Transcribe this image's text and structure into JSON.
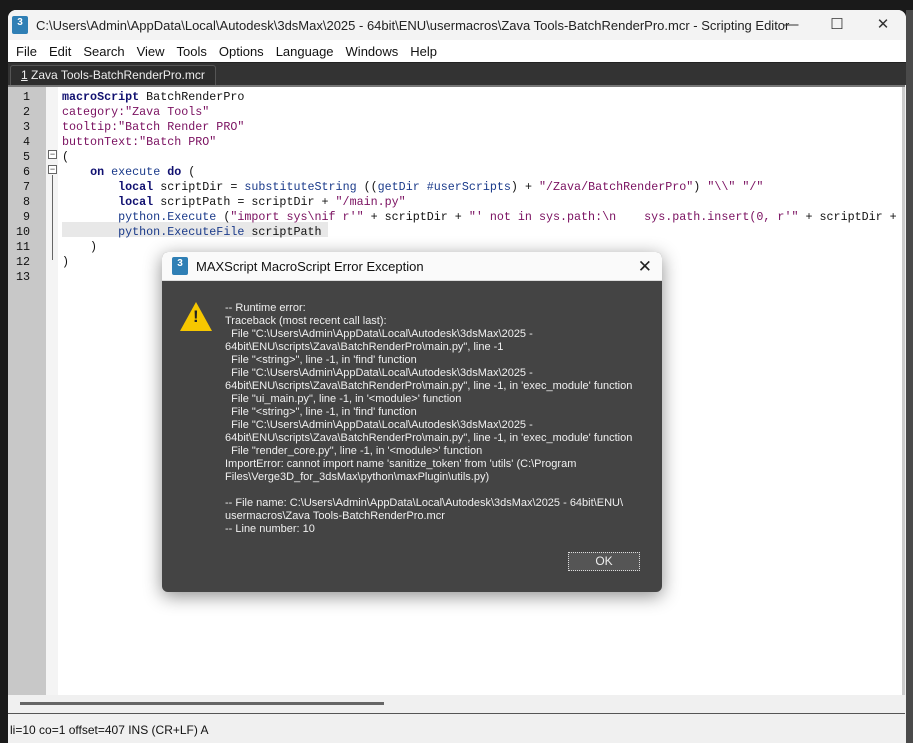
{
  "window": {
    "title": "C:\\Users\\Admin\\AppData\\Local\\Autodesk\\3dsMax\\2025 - 64bit\\ENU\\usermacros\\Zava Tools-BatchRenderPro.mcr - Scripting Editor",
    "icon": "3",
    "minimize": "—",
    "maximize": "☐",
    "close": "✕"
  },
  "menu": [
    "File",
    "Edit",
    "Search",
    "View",
    "Tools",
    "Options",
    "Language",
    "Windows",
    "Help"
  ],
  "tab": {
    "index": "1",
    "label": " Zava Tools-BatchRenderPro.mcr"
  },
  "code": [
    [
      [
        "kw",
        "macroScript"
      ],
      [
        "t",
        " BatchRenderPro"
      ]
    ],
    [
      [
        "prop",
        "category:"
      ],
      [
        "str",
        "\"Zava Tools\""
      ]
    ],
    [
      [
        "prop",
        "tooltip:"
      ],
      [
        "str",
        "\"Batch Render PRO\""
      ]
    ],
    [
      [
        "prop",
        "buttonText:"
      ],
      [
        "str",
        "\"Batch PRO\""
      ]
    ],
    [
      [
        "t",
        "("
      ]
    ],
    [
      [
        "t",
        "    "
      ],
      [
        "kw",
        "on"
      ],
      [
        "t",
        " "
      ],
      [
        "fn",
        "execute"
      ],
      [
        "t",
        " "
      ],
      [
        "kw",
        "do"
      ],
      [
        "t",
        " ("
      ]
    ],
    [
      [
        "t",
        "        "
      ],
      [
        "kw",
        "local"
      ],
      [
        "t",
        " scriptDir = "
      ],
      [
        "fn",
        "substituteString"
      ],
      [
        "t",
        " (("
      ],
      [
        "fn",
        "getDir"
      ],
      [
        "t",
        " "
      ],
      [
        "fn",
        "#userScripts"
      ],
      [
        "t",
        ") + "
      ],
      [
        "str",
        "\"/Zava/BatchRenderPro\""
      ],
      [
        "t",
        ") "
      ],
      [
        "str",
        "\"\\\\\""
      ],
      [
        "t",
        " "
      ],
      [
        "str",
        "\"/\""
      ]
    ],
    [
      [
        "t",
        "        "
      ],
      [
        "kw",
        "local"
      ],
      [
        "t",
        " scriptPath = scriptDir + "
      ],
      [
        "str",
        "\"/main.py\""
      ]
    ],
    [
      [
        "t",
        "        "
      ],
      [
        "fn",
        "python.Execute"
      ],
      [
        "t",
        " ("
      ],
      [
        "str",
        "\"import sys\\nif r'\""
      ],
      [
        "t",
        " + scriptDir + "
      ],
      [
        "str",
        "\"' not in sys.path:\\n    sys.path.insert(0, r'\""
      ],
      [
        "t",
        " + scriptDir +"
      ]
    ],
    [
      [
        "t",
        "        "
      ],
      [
        "fn",
        "python.ExecuteFile"
      ],
      [
        "t",
        " scriptPath"
      ]
    ],
    [
      [
        "t",
        "    )"
      ]
    ],
    [
      [
        "t",
        ")"
      ]
    ],
    [
      [
        "t",
        ""
      ]
    ]
  ],
  "status": "li=10 co=1 offset=407 INS (CR+LF) A",
  "dialog": {
    "title": "MAXScript MacroScript Error Exception",
    "icon": "warning-icon",
    "message": "-- Runtime error:\nTraceback (most recent call last):\n  File \"C:\\Users\\Admin\\AppData\\Local\\Autodesk\\3dsMax\\2025 -\n64bit\\ENU\\scripts\\Zava\\BatchRenderPro\\main.py\", line -1\n  File \"<string>\", line -1, in 'find' function\n  File \"C:\\Users\\Admin\\AppData\\Local\\Autodesk\\3dsMax\\2025 -\n64bit\\ENU\\scripts\\Zava\\BatchRenderPro\\main.py\", line -1, in 'exec_module' function\n  File \"ui_main.py\", line -1, in '<module>' function\n  File \"<string>\", line -1, in 'find' function\n  File \"C:\\Users\\Admin\\AppData\\Local\\Autodesk\\3dsMax\\2025 -\n64bit\\ENU\\scripts\\Zava\\BatchRenderPro\\main.py\", line -1, in 'exec_module' function\n  File \"render_core.py\", line -1, in '<module>' function\nImportError: cannot import name 'sanitize_token' from 'utils' (C:\\Program\nFiles\\Verge3D_for_3dsMax\\python\\maxPlugin\\utils.py)\n\n-- File name: C:\\Users\\Admin\\AppData\\Local\\Autodesk\\3dsMax\\2025 - 64bit\\ENU\\\nusermacros\\Zava Tools-BatchRenderPro.mcr\n-- Line number: 10",
    "ok": "OK",
    "close": "✕"
  }
}
